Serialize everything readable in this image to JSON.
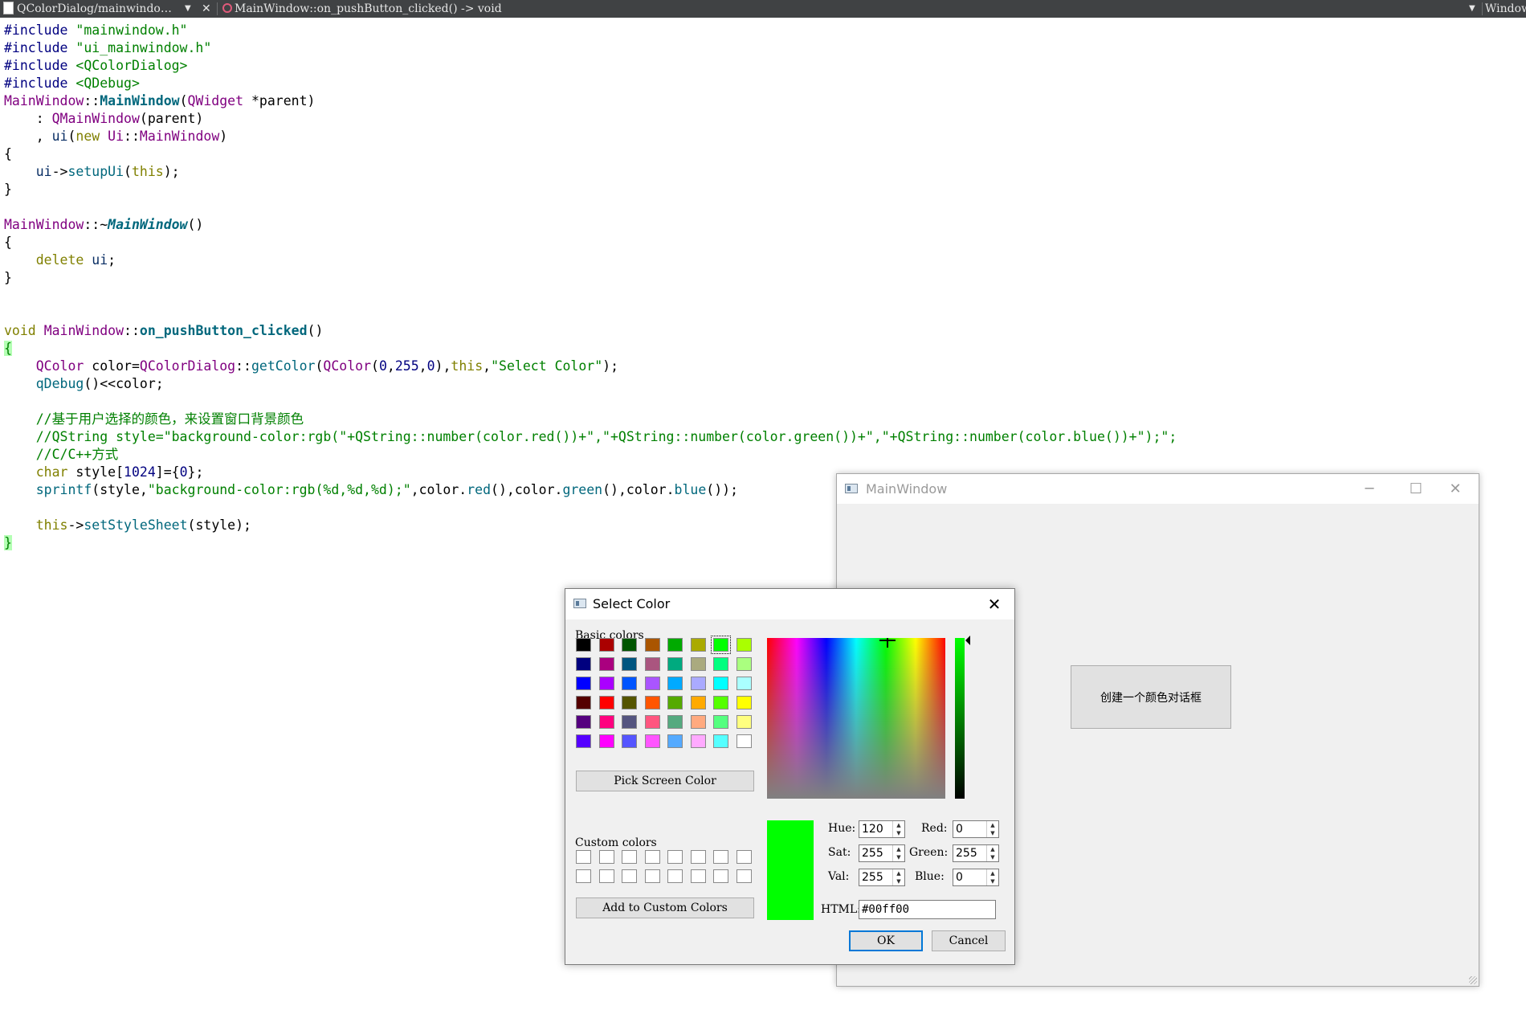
{
  "editor": {
    "file_selector": "QColorDialog/mainwindo…",
    "symbol_selector": "MainWindow::on_pushButton_clicked() -> void",
    "right_selector": "Windows"
  },
  "main_window": {
    "title": "MainWindow",
    "button_label": "创建一个颜色对话框"
  },
  "color_dialog": {
    "title": "Select Color",
    "basic_colors_label": "Basic colors",
    "pick_screen_label": "Pick Screen Color",
    "custom_colors_label": "Custom colors",
    "add_custom_label": "Add to Custom Colors",
    "basic_colors": [
      [
        "#000000",
        "#aa0000",
        "#005500",
        "#aa5500",
        "#00aa00",
        "#aaaa00",
        "#00ff00",
        "#aaff00"
      ],
      [
        "#00007f",
        "#aa007f",
        "#00557f",
        "#aa557f",
        "#00aa7f",
        "#aaaa7f",
        "#00ff7f",
        "#aaff7f"
      ],
      [
        "#0000ff",
        "#aa00ff",
        "#0055ff",
        "#aa55ff",
        "#00aaff",
        "#aaaaff",
        "#00ffff",
        "#aaffff"
      ],
      [
        "#550000",
        "#ff0000",
        "#555500",
        "#ff5500",
        "#55aa00",
        "#ffaa00",
        "#55ff00",
        "#ffff00"
      ],
      [
        "#55007f",
        "#ff007f",
        "#55557f",
        "#ff557f",
        "#55aa7f",
        "#ffaa7f",
        "#55ff7f",
        "#ffff7f"
      ],
      [
        "#5500ff",
        "#ff00ff",
        "#5555ff",
        "#ff55ff",
        "#55aaff",
        "#ffaaff",
        "#55ffff",
        "#ffffff"
      ]
    ],
    "selected_color": "#00ff00",
    "hue_label": "Hue:",
    "hue": "120",
    "sat_label": "Sat:",
    "sat": "255",
    "val_label": "Val:",
    "val": "255",
    "red_label": "Red:",
    "red": "0",
    "green_label": "Green:",
    "green": "255",
    "blue_label": "Blue:",
    "blue": "0",
    "html_label": "HTML:",
    "html": "#00ff00",
    "ok_label": "OK",
    "cancel_label": "Cancel"
  },
  "code": {
    "inc1": "\"mainwindow.h\"",
    "inc2": "\"ui_mainwindow.h\"",
    "inc3": "<QColorDialog>",
    "inc4": "<QDebug>",
    "getcolor_str": "\"Select Color\"",
    "comment1": "//基于用户选择的颜色，来设置窗口背景颜色",
    "comment2": "//QString style=\"background-color:rgb(\"+QString::number(color.red())+\",\"+QString::number(color.green())+\",\"+QString::number(color.blue())+\");\";",
    "comment3": "//C/C++方式",
    "sprintf_str": "\"background-color:rgb(%d,%d,%d);\""
  }
}
